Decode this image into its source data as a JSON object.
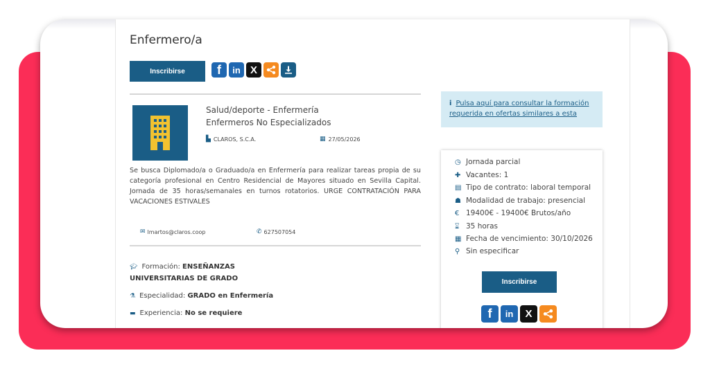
{
  "job": {
    "title": "Enfermero/a",
    "apply_label": "Inscribirse",
    "category": "Salud/deporte - Enfermería",
    "subcategory": "Enfermeros No Especializados",
    "company": "CLAROS, S.C.A.",
    "date": "27/05/2026",
    "description": "Se busca Diplomado/a o Graduado/a en Enfermería para realizar tareas propia de su categoría profesional en Centro Residencial de Mayores situado en Sevilla Capital. Jornada de 35 horas/semanales en turnos rotatorios. URGE CONTRATACIÓN PARA VACACIONES ESTIVALES",
    "email": "lmartos@claros.coop",
    "phone": "627507054"
  },
  "requirements": {
    "formacion_label": "Formación:",
    "formacion_value_1": "ENSEÑANZAS",
    "formacion_value_2": "UNIVERSITARIAS DE GRADO",
    "especialidad_label": "Especialidad:",
    "especialidad_value": "GRADO en Enfermería",
    "experiencia_label": "Experiencia:",
    "experiencia_value": "No se requiere"
  },
  "info_box": {
    "line1": "Pulsa aquí para consultar la formación",
    "line2": "requerida en ofertas similares a esta"
  },
  "summary": {
    "jornada": "Jornada parcial",
    "vacantes": "Vacantes: 1",
    "contrato": "Tipo de contrato: laboral temporal",
    "modalidad": "Modalidad de trabajo: presencial",
    "salario": "19400€ - 19400€ Brutos/año",
    "horas": "35 horas",
    "vencimiento": "Fecha de vencimiento: 30/10/2026",
    "ubicacion": "Sin especificar",
    "apply_label": "Inscribirse"
  },
  "share": {
    "facebook": "f",
    "linkedin": "in",
    "x": "X"
  },
  "icons": [
    "facebook-icon",
    "linkedin-icon",
    "x-icon",
    "share-icon",
    "download-icon",
    "building-icon",
    "calendar-icon",
    "envelope-icon",
    "phone-icon",
    "graduation-cap-icon",
    "flask-icon",
    "briefcase-icon",
    "info-icon",
    "clock-icon",
    "users-icon",
    "file-icon",
    "group-icon",
    "euro-icon",
    "hourglass-icon",
    "map-marker-icon"
  ],
  "colors": {
    "primary": "#1a5d86",
    "accent_red": "#fb2d57",
    "share_orange": "#f58a1f",
    "info_bg": "#d5ebf4"
  }
}
